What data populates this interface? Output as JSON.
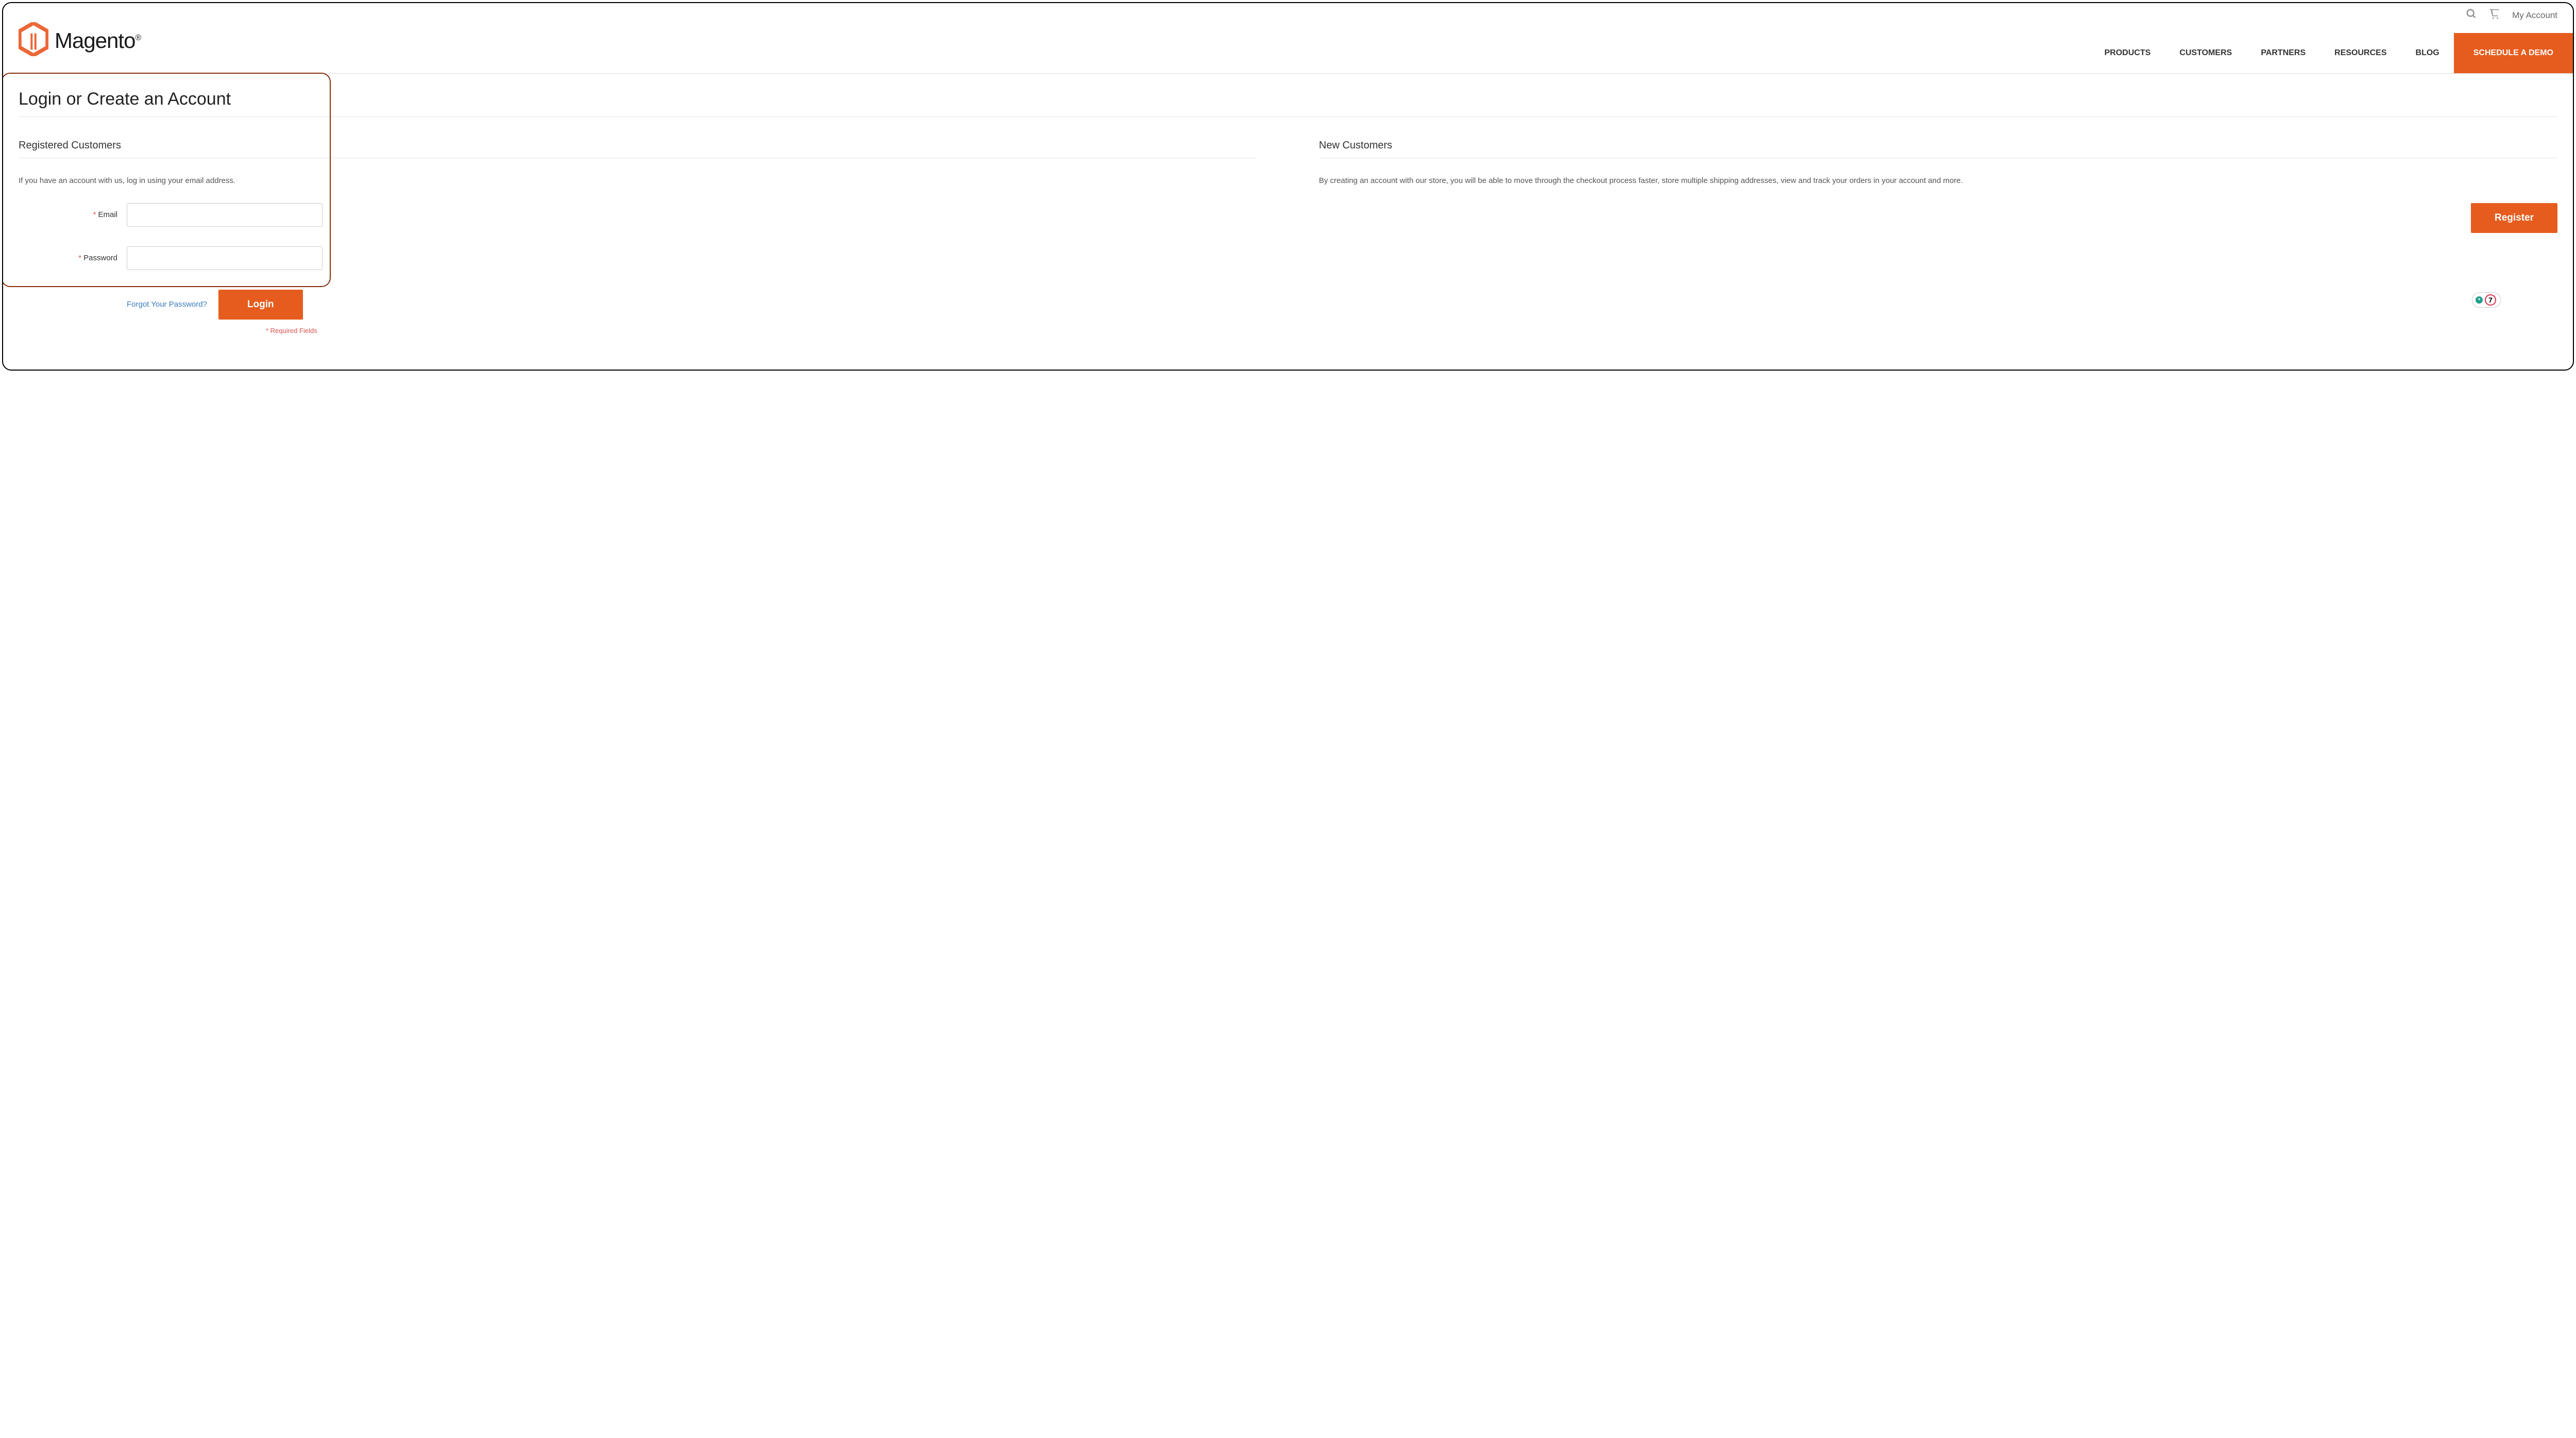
{
  "topbar": {
    "my_account": "My Account"
  },
  "brand": {
    "name": "Magento",
    "reg": "®"
  },
  "nav": {
    "items": [
      "PRODUCTS",
      "CUSTOMERS",
      "PARTNERS",
      "RESOURCES",
      "BLOG"
    ],
    "cta": "SCHEDULE A DEMO"
  },
  "page": {
    "title": "Login or Create an Account"
  },
  "login": {
    "heading": "Registered Customers",
    "desc": "If you have an account with us, log in using your email address.",
    "email_label": "Email",
    "password_label": "Password",
    "forgot": "Forgot Your Password?",
    "button": "Login",
    "required_note": "* Required Fields",
    "req_mark": "*"
  },
  "register": {
    "heading": "New Customers",
    "desc": "By creating an account with our store, you will be able to move through the checkout process faster, store multiple shipping addresses, view and track your orders in your account and more.",
    "button": "Register"
  },
  "widget": {
    "count": "7"
  }
}
